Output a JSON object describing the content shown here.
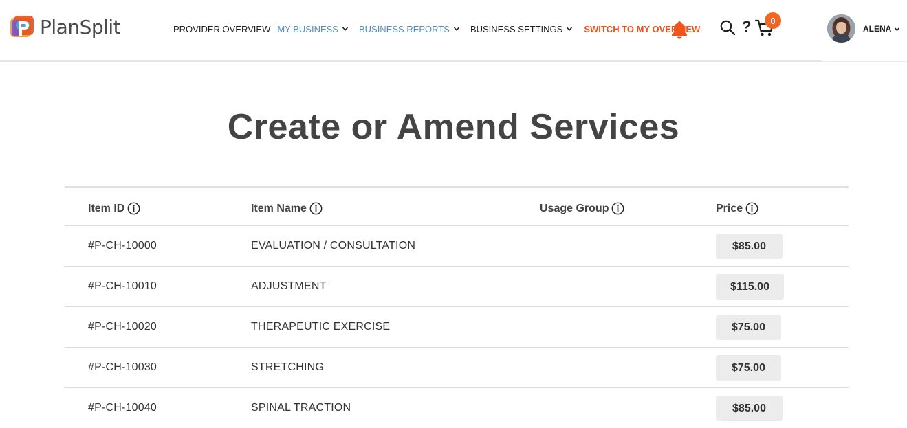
{
  "brand": {
    "name": "PlanSplit"
  },
  "nav": {
    "items": [
      {
        "label": "PROVIDER OVERVIEW",
        "dropdown": false
      },
      {
        "label": "MY BUSINESS",
        "dropdown": true
      },
      {
        "label": "BUSINESS REPORTS",
        "dropdown": true
      },
      {
        "label": "BUSINESS SETTINGS",
        "dropdown": true
      },
      {
        "label": "SWITCH TO MY OVERVIEW",
        "dropdown": false
      }
    ]
  },
  "toolbar": {
    "help_label": "?",
    "cart_count": "0"
  },
  "user": {
    "name": "ALENA"
  },
  "page": {
    "title": "Create or Amend Services"
  },
  "table": {
    "headers": [
      "Item ID",
      "Item Name",
      "Usage Group",
      "Price"
    ],
    "rows": [
      {
        "id": "#P-CH-10000",
        "name": "EVALUATION / CONSULTATION",
        "usage_group": "",
        "price": "$85.00"
      },
      {
        "id": "#P-CH-10010",
        "name": "ADJUSTMENT",
        "usage_group": "",
        "price": "$115.00"
      },
      {
        "id": "#P-CH-10020",
        "name": "THERAPEUTIC EXERCISE",
        "usage_group": "",
        "price": "$75.00"
      },
      {
        "id": "#P-CH-10030",
        "name": "STRETCHING",
        "usage_group": "",
        "price": "$75.00"
      },
      {
        "id": "#P-CH-10040",
        "name": "SPINAL TRACTION",
        "usage_group": "",
        "price": "$85.00"
      }
    ]
  },
  "colors": {
    "nav_blue": "#4f8fc0",
    "accent_orange": "#e8541e",
    "badge_orange": "#f26522"
  },
  "icons": [
    "bell-icon",
    "search-icon",
    "help-icon",
    "cart-icon",
    "info-icon",
    "chevron-down-icon"
  ]
}
